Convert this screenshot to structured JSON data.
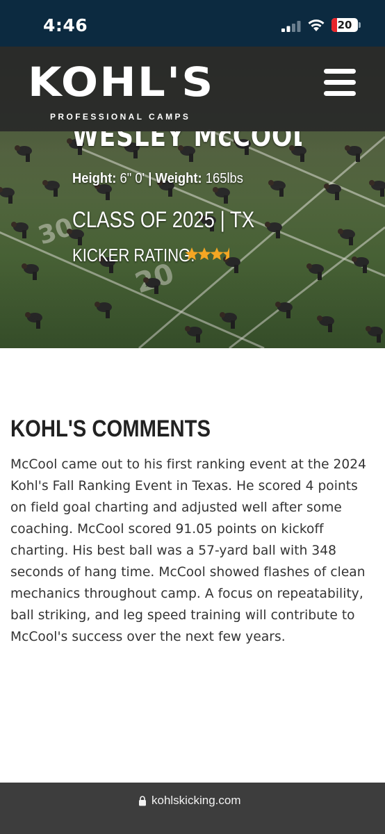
{
  "status_bar": {
    "time": "4:46",
    "battery_level": "20",
    "battery_color": "#e8252a"
  },
  "header": {
    "logo_text": "KOHL'S",
    "logo_subtitle": "PROFESSIONAL CAMPS",
    "menu_icon": "hamburger-menu-icon"
  },
  "player": {
    "name": "WESLEY McCOOL",
    "height_label": "Height:",
    "height_value": "6\" 0'",
    "separator": "|",
    "weight_label": "Weight:",
    "weight_value": "165lbs",
    "class_line": "CLASS OF 2025 | TX",
    "rating_label": "KICKER RATING:",
    "rating_stars": 3.5,
    "rating_max": 5,
    "star_color": "#f5a623"
  },
  "comments": {
    "title": "KOHL'S COMMENTS",
    "body": "McCool came out to his first ranking event at the 2024 Kohl's Fall Ranking Event in Texas. He scored 4 points on field goal charting and adjusted well after some coaching. McCool scored 91.05 points on kickoff charting. His best ball was a 57-yard ball with 348 seconds of hang time. McCool showed flashes of clean mechanics throughout camp. A focus on repeatability, ball striking, and leg speed training will contribute to McCool's success over the next few years."
  },
  "browser": {
    "url": "kohlskicking.com"
  }
}
